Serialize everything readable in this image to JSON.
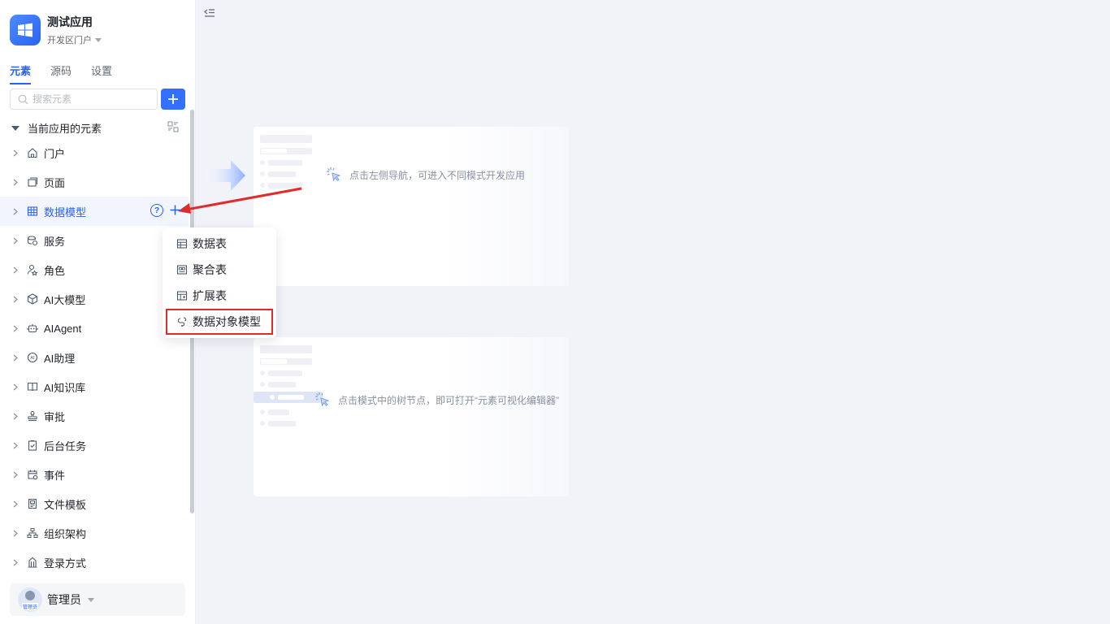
{
  "app": {
    "title": "测试应用",
    "subtitle": "开发区门户"
  },
  "tabs": [
    {
      "label": "元素"
    },
    {
      "label": "源码"
    },
    {
      "label": "设置"
    }
  ],
  "search": {
    "placeholder": "搜索元素"
  },
  "section": {
    "title": "当前应用的元素"
  },
  "tree": [
    {
      "label": "门户",
      "icon": "home-icon"
    },
    {
      "label": "页面",
      "icon": "page-icon"
    },
    {
      "label": "数据模型",
      "icon": "table-icon"
    },
    {
      "label": "服务",
      "icon": "service-icon"
    },
    {
      "label": "角色",
      "icon": "role-icon"
    },
    {
      "label": "AI大模型",
      "icon": "cube-icon"
    },
    {
      "label": "AIAgent",
      "icon": "robot-icon"
    },
    {
      "label": "AI助理",
      "icon": "ai-assistant-icon"
    },
    {
      "label": "AI知识库",
      "icon": "book-icon"
    },
    {
      "label": "审批",
      "icon": "stamp-icon"
    },
    {
      "label": "后台任务",
      "icon": "clipboard-check-icon"
    },
    {
      "label": "事件",
      "icon": "calendar-icon"
    },
    {
      "label": "文件模板",
      "icon": "file-template-icon"
    },
    {
      "label": "组织架构",
      "icon": "org-chart-icon"
    },
    {
      "label": "登录方式",
      "icon": "building-icon"
    }
  ],
  "menu": [
    {
      "label": "数据表",
      "icon": "table-icon"
    },
    {
      "label": "聚合表",
      "icon": "aggregate-table-icon"
    },
    {
      "label": "扩展表",
      "icon": "extend-table-icon"
    },
    {
      "label": "数据对象模型",
      "icon": "data-object-icon"
    }
  ],
  "user": {
    "name": "管理员",
    "avatar_tag": "管理员"
  },
  "hints": {
    "nav": "点击左侧导航，可进入不同模式开发应用",
    "tree": "点击模式中的树节点，即可打开“元素可视化编辑器”"
  },
  "colors": {
    "accent": "#2a62f0",
    "annotation": "#e02b2b"
  }
}
